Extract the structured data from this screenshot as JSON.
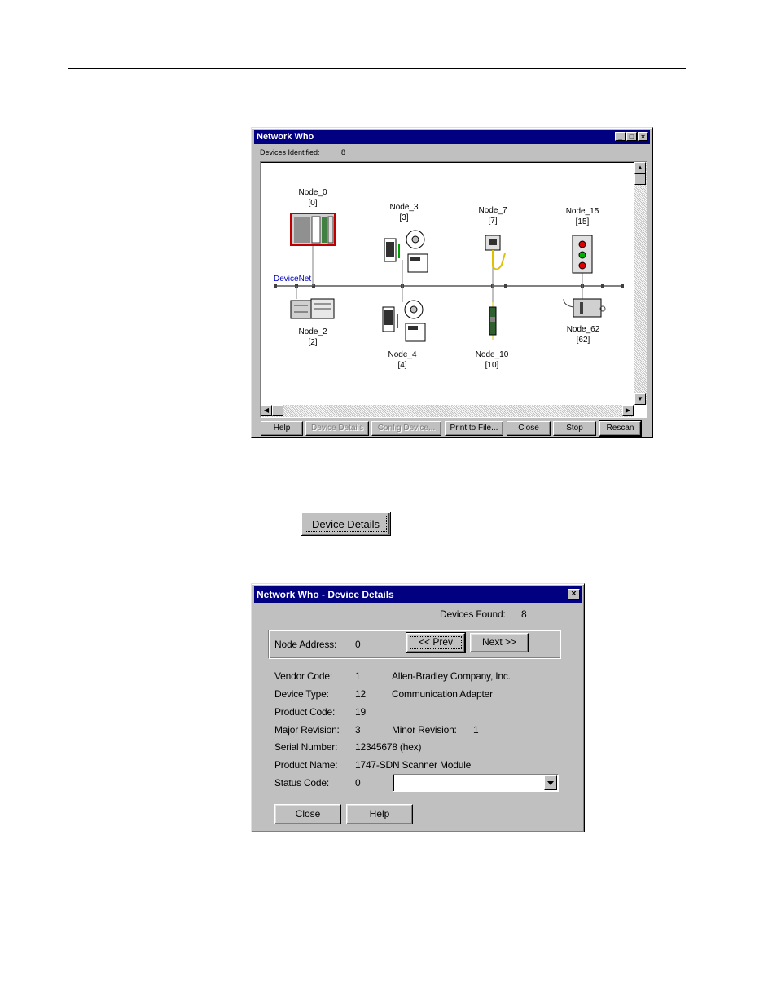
{
  "network_window": {
    "title": "Network Who",
    "devices_identified_label": "Devices Identified:",
    "devices_identified_value": "8",
    "network_label": "DeviceNet",
    "nodes": [
      {
        "name": "Node_0",
        "address": "[0]"
      },
      {
        "name": "Node_3",
        "address": "[3]"
      },
      {
        "name": "Node_7",
        "address": "[7]"
      },
      {
        "name": "Node_15",
        "address": "[15]"
      },
      {
        "name": "Node_2",
        "address": "[2]"
      },
      {
        "name": "Node_4",
        "address": "[4]"
      },
      {
        "name": "Node_10",
        "address": "[10]"
      },
      {
        "name": "Node_62",
        "address": "[62]"
      }
    ],
    "buttons": {
      "help": "Help",
      "device_details": "Device Details",
      "config_device": "Config Device...",
      "print_to_file": "Print to File...",
      "close": "Close",
      "stop": "Stop",
      "rescan": "Rescan"
    }
  },
  "standalone_button": {
    "label": "Device Details"
  },
  "details_dialog": {
    "title": "Network Who - Device Details",
    "devices_found_label": "Devices Found:",
    "devices_found_value": "8",
    "node_address_label": "Node Address:",
    "node_address_value": "0",
    "prev_label": "<< Prev",
    "next_label": "Next >>",
    "fields": {
      "vendor_code_label": "Vendor Code:",
      "vendor_code_value": "1",
      "vendor_name": "Allen-Bradley Company, Inc.",
      "device_type_label": "Device Type:",
      "device_type_value": "12",
      "device_type_name": "Communication Adapter",
      "product_code_label": "Product Code:",
      "product_code_value": "19",
      "major_revision_label": "Major Revision:",
      "major_revision_value": "3",
      "minor_revision_label": "Minor Revision:",
      "minor_revision_value": "1",
      "serial_number_label": "Serial Number:",
      "serial_number_value": "12345678 (hex)",
      "product_name_label": "Product Name:",
      "product_name_value": "1747-SDN Scanner Module",
      "status_code_label": "Status Code:",
      "status_code_value": "0"
    },
    "close_label": "Close",
    "help_label": "Help"
  }
}
